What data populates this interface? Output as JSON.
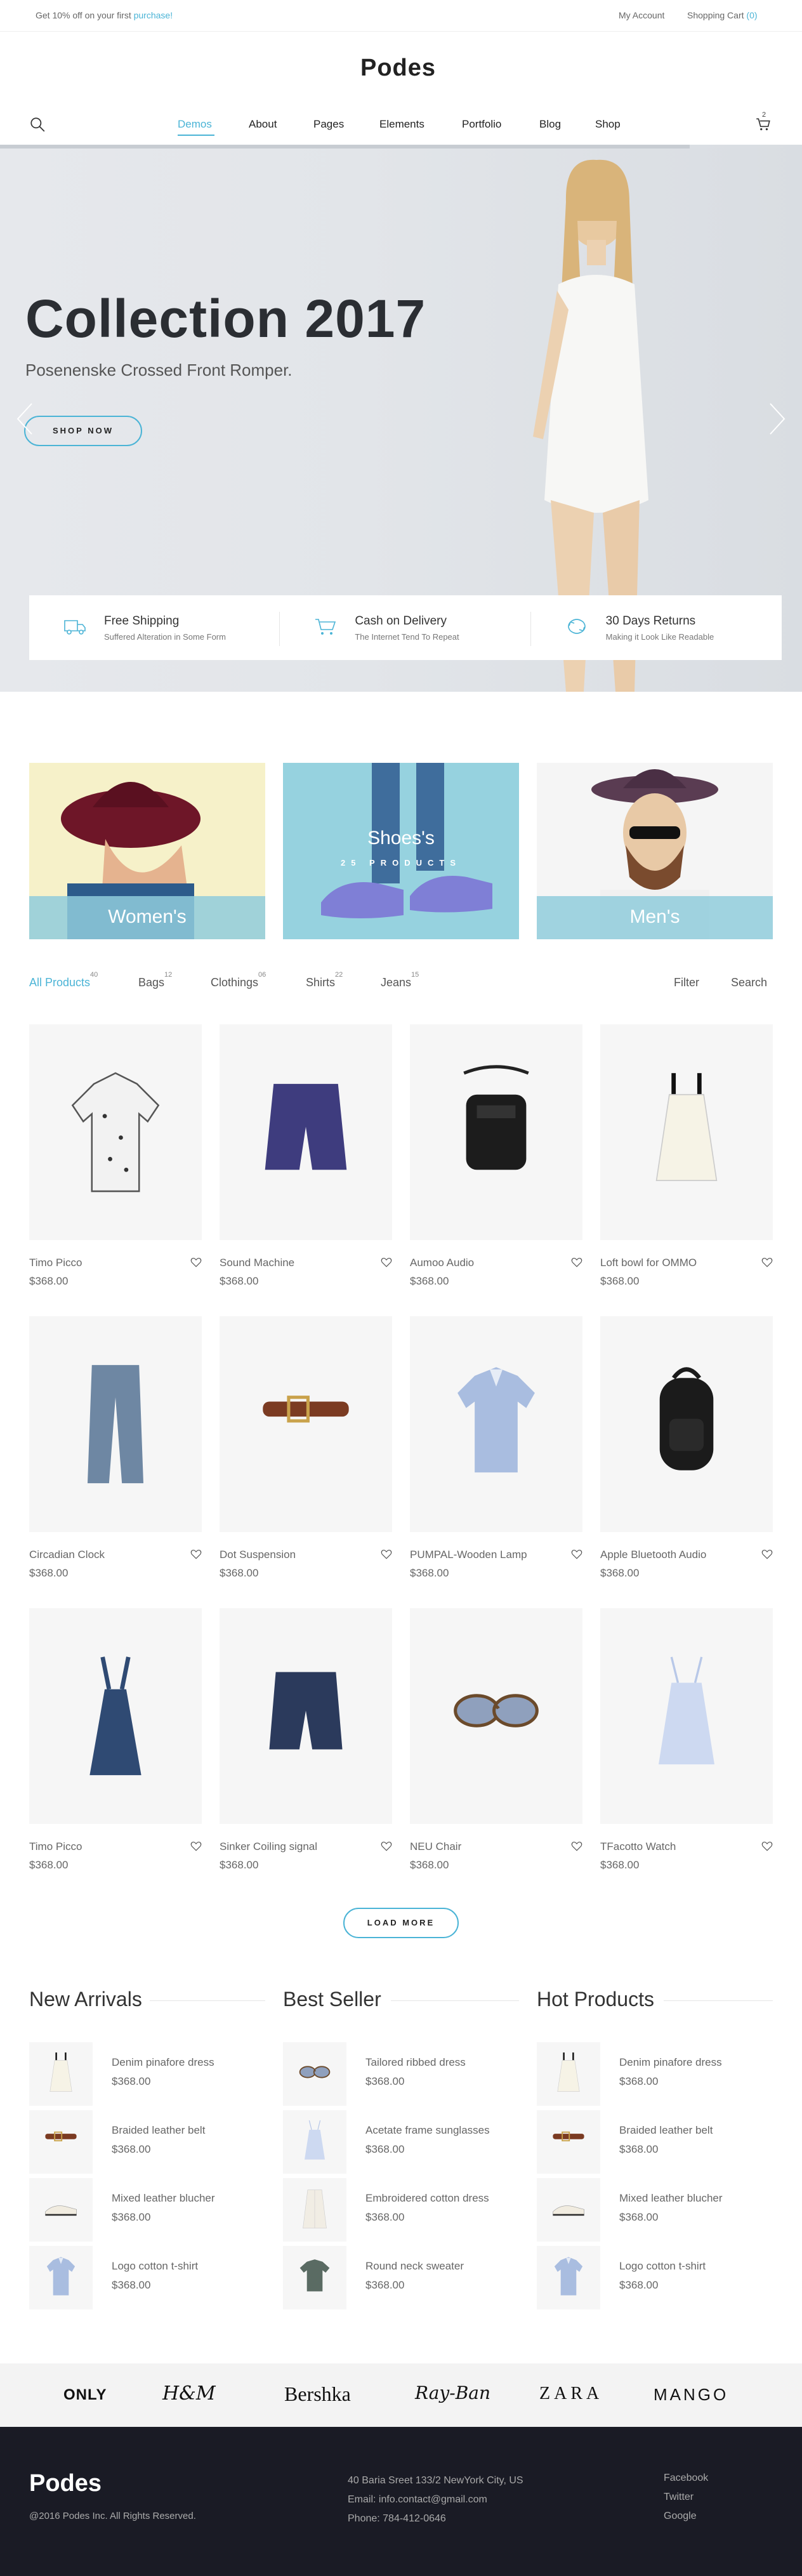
{
  "topbar": {
    "promo_text": "Get 10% off on your first",
    "promo_link": "purchase!",
    "my_account": "My Account",
    "shopping_cart": "Shopping Cart",
    "cart_count": "(0)"
  },
  "header": {
    "logo": "Podes",
    "cart_badge": "2",
    "nav": [
      "Demos",
      "About",
      "Pages",
      "Elements",
      "Portfolio",
      "Blog",
      "Shop"
    ]
  },
  "hero": {
    "title": "Collection 2017",
    "subtitle": "Posenenske Crossed Front Romper.",
    "button": "SHOP NOW",
    "slider_progress": 0.86
  },
  "features": [
    {
      "title": "Free Shipping",
      "sub": "Suffered Alteration in Some Form",
      "icon": "truck-icon"
    },
    {
      "title": "Cash on Delivery",
      "sub": "The Internet Tend To Repeat",
      "icon": "cart-icon"
    },
    {
      "title": "30 Days Returns",
      "sub": "Making it Look Like Readable",
      "icon": "return-icon"
    }
  ],
  "categories": [
    {
      "label": "Women's",
      "sub": ""
    },
    {
      "label": "Shoes's",
      "sub": "25 PRODUCTS"
    },
    {
      "label": "Men's",
      "sub": ""
    }
  ],
  "filters": {
    "tabs": [
      {
        "label": "All Products",
        "count": "40"
      },
      {
        "label": "Bags",
        "count": "12"
      },
      {
        "label": "Clothings",
        "count": "06"
      },
      {
        "label": "Shirts",
        "count": "22"
      },
      {
        "label": "Jeans",
        "count": "15"
      }
    ],
    "filter": "Filter",
    "search": "Search"
  },
  "products": [
    {
      "name": "Timo Picco",
      "price": "$368.00",
      "icon": "shirt-icon"
    },
    {
      "name": "Sound Machine",
      "price": "$368.00",
      "icon": "shorts-icon"
    },
    {
      "name": "Aumoo Audio",
      "price": "$368.00",
      "icon": "bag-icon"
    },
    {
      "name": "Loft bowl for OMMO",
      "price": "$368.00",
      "icon": "dress-icon"
    },
    {
      "name": "Circadian Clock",
      "price": "$368.00",
      "icon": "pants-icon"
    },
    {
      "name": "Dot Suspension",
      "price": "$368.00",
      "icon": "belt-icon"
    },
    {
      "name": "PUMPAL-Wooden Lamp",
      "price": "$368.00",
      "icon": "shirt-blue-icon"
    },
    {
      "name": "Apple Bluetooth Audio",
      "price": "$368.00",
      "icon": "backpack-icon"
    },
    {
      "name": "Timo Picco",
      "price": "$368.00",
      "icon": "pinafore-icon"
    },
    {
      "name": "Sinker Coiling signal",
      "price": "$368.00",
      "icon": "shorts-navy-icon"
    },
    {
      "name": "NEU Chair",
      "price": "$368.00",
      "icon": "sunglasses-icon"
    },
    {
      "name": "TFacotto Watch",
      "price": "$368.00",
      "icon": "camisole-icon"
    }
  ],
  "load_more": "LOAD MORE",
  "lists": [
    {
      "title": "New Arrivals",
      "items": [
        {
          "name": "Denim pinafore dress",
          "price": "$368.00",
          "icon": "dress-icon"
        },
        {
          "name": "Braided leather belt",
          "price": "$368.00",
          "icon": "belt-icon"
        },
        {
          "name": "Mixed leather blucher",
          "price": "$368.00",
          "icon": "shoe-icon"
        },
        {
          "name": "Logo cotton t-shirt",
          "price": "$368.00",
          "icon": "shirt-blue-icon"
        }
      ]
    },
    {
      "title": "Best Seller",
      "items": [
        {
          "name": "Tailored ribbed dress",
          "price": "$368.00",
          "icon": "sunglasses-icon"
        },
        {
          "name": "Acetate frame sunglasses",
          "price": "$368.00",
          "icon": "camisole-icon"
        },
        {
          "name": "Embroidered cotton dress",
          "price": "$368.00",
          "icon": "coat-icon"
        },
        {
          "name": "Round neck sweater",
          "price": "$368.00",
          "icon": "tshirt-icon"
        }
      ]
    },
    {
      "title": "Hot Products",
      "items": [
        {
          "name": "Denim pinafore dress",
          "price": "$368.00",
          "icon": "dress-icon"
        },
        {
          "name": "Braided leather belt",
          "price": "$368.00",
          "icon": "belt-icon"
        },
        {
          "name": "Mixed leather blucher",
          "price": "$368.00",
          "icon": "shoe-icon"
        },
        {
          "name": "Logo cotton t-shirt",
          "price": "$368.00",
          "icon": "shirt-blue-icon"
        }
      ]
    }
  ],
  "brands": [
    "ONLY",
    "H&M",
    "Bershka",
    "Ray-Ban",
    "ZARA",
    "MANGO"
  ],
  "footer": {
    "logo": "Podes",
    "copyright": "@2016 Podes Inc. All Rights Reserved.",
    "address": "40 Baria Sreet 133/2 NewYork City, US",
    "email": "Email: info.contact@gmail.com",
    "phone": "Phone: 784-412-0646",
    "links": [
      "Facebook",
      "Twitter",
      "Google"
    ]
  },
  "colors": {
    "accent": "#4bb4d6",
    "footer_bg": "#1a1b25",
    "category_band": "#90cddc"
  }
}
